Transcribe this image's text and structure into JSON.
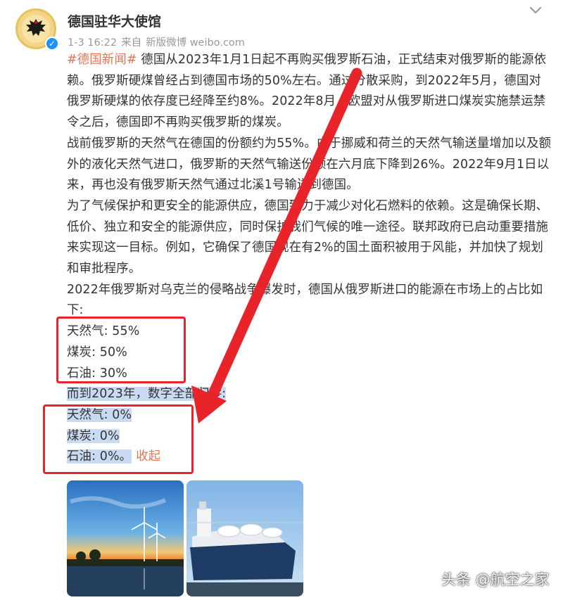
{
  "header": {
    "username": "德国驻华大使馆",
    "time": "1-3 16:22",
    "source_prefix": "来自",
    "source": "新版微博 weibo.com"
  },
  "post": {
    "hashtag": "#德国新闻#",
    "p1": "德国从2023年1月1日起不再购买俄罗斯石油，正式结束对俄罗斯的能源依赖。俄罗斯硬煤曾经占到德国市场的50%左右。通过分散采购，到2022年5月，德国对俄罗斯硬煤的依存度已经降至约8%。2022年8月，欧盟对从俄罗斯进口煤炭实施禁运禁令之后，德国即不再购买俄罗斯的煤炭。",
    "p2": "战前俄罗斯的天然气在德国的份额约为55%。由于挪威和荷兰的天然气输送量增加以及额外的液化天然气进口，俄罗斯的天然气输送份额在六月底下降到26%。2022年9月1日以来，再也没有俄罗斯天然气通过北溪1号输送到德国。",
    "p3": "为了气候保护和更安全的能源供应，德国致力于减少对化石燃料的依赖。这是确保长期、低价、独立和安全的能源供应，同时保护我们气候的唯一途径。联邦政府已启动重要措施来实现这一目标。例如，它确保了德国现在有2%的国土面积被用于风能，并加快了规划和审批程序。",
    "p4": "2022年俄罗斯对乌克兰的侵略战争爆发时，德国从俄罗斯进口的能源在市场上的占比如下:",
    "before": [
      "天然气: 55%",
      "煤炭: 50%",
      "石油: 30%"
    ],
    "transition": "而到2023年，数字全部归零:",
    "after": [
      "天然气: 0%",
      "煤炭: 0%",
      "石油: 0%。"
    ],
    "collapse_label": "收起"
  },
  "watermark": "头条 @航空之家",
  "colors": {
    "link": "#eb7350",
    "annotation": "#e8232a",
    "selection": "#c8dbf3",
    "verified": "#1e90ff"
  },
  "icons": {
    "avatar": "german-eagle-emblem",
    "verified": "verified-badge-icon",
    "menu": "chevron-down-icon"
  }
}
